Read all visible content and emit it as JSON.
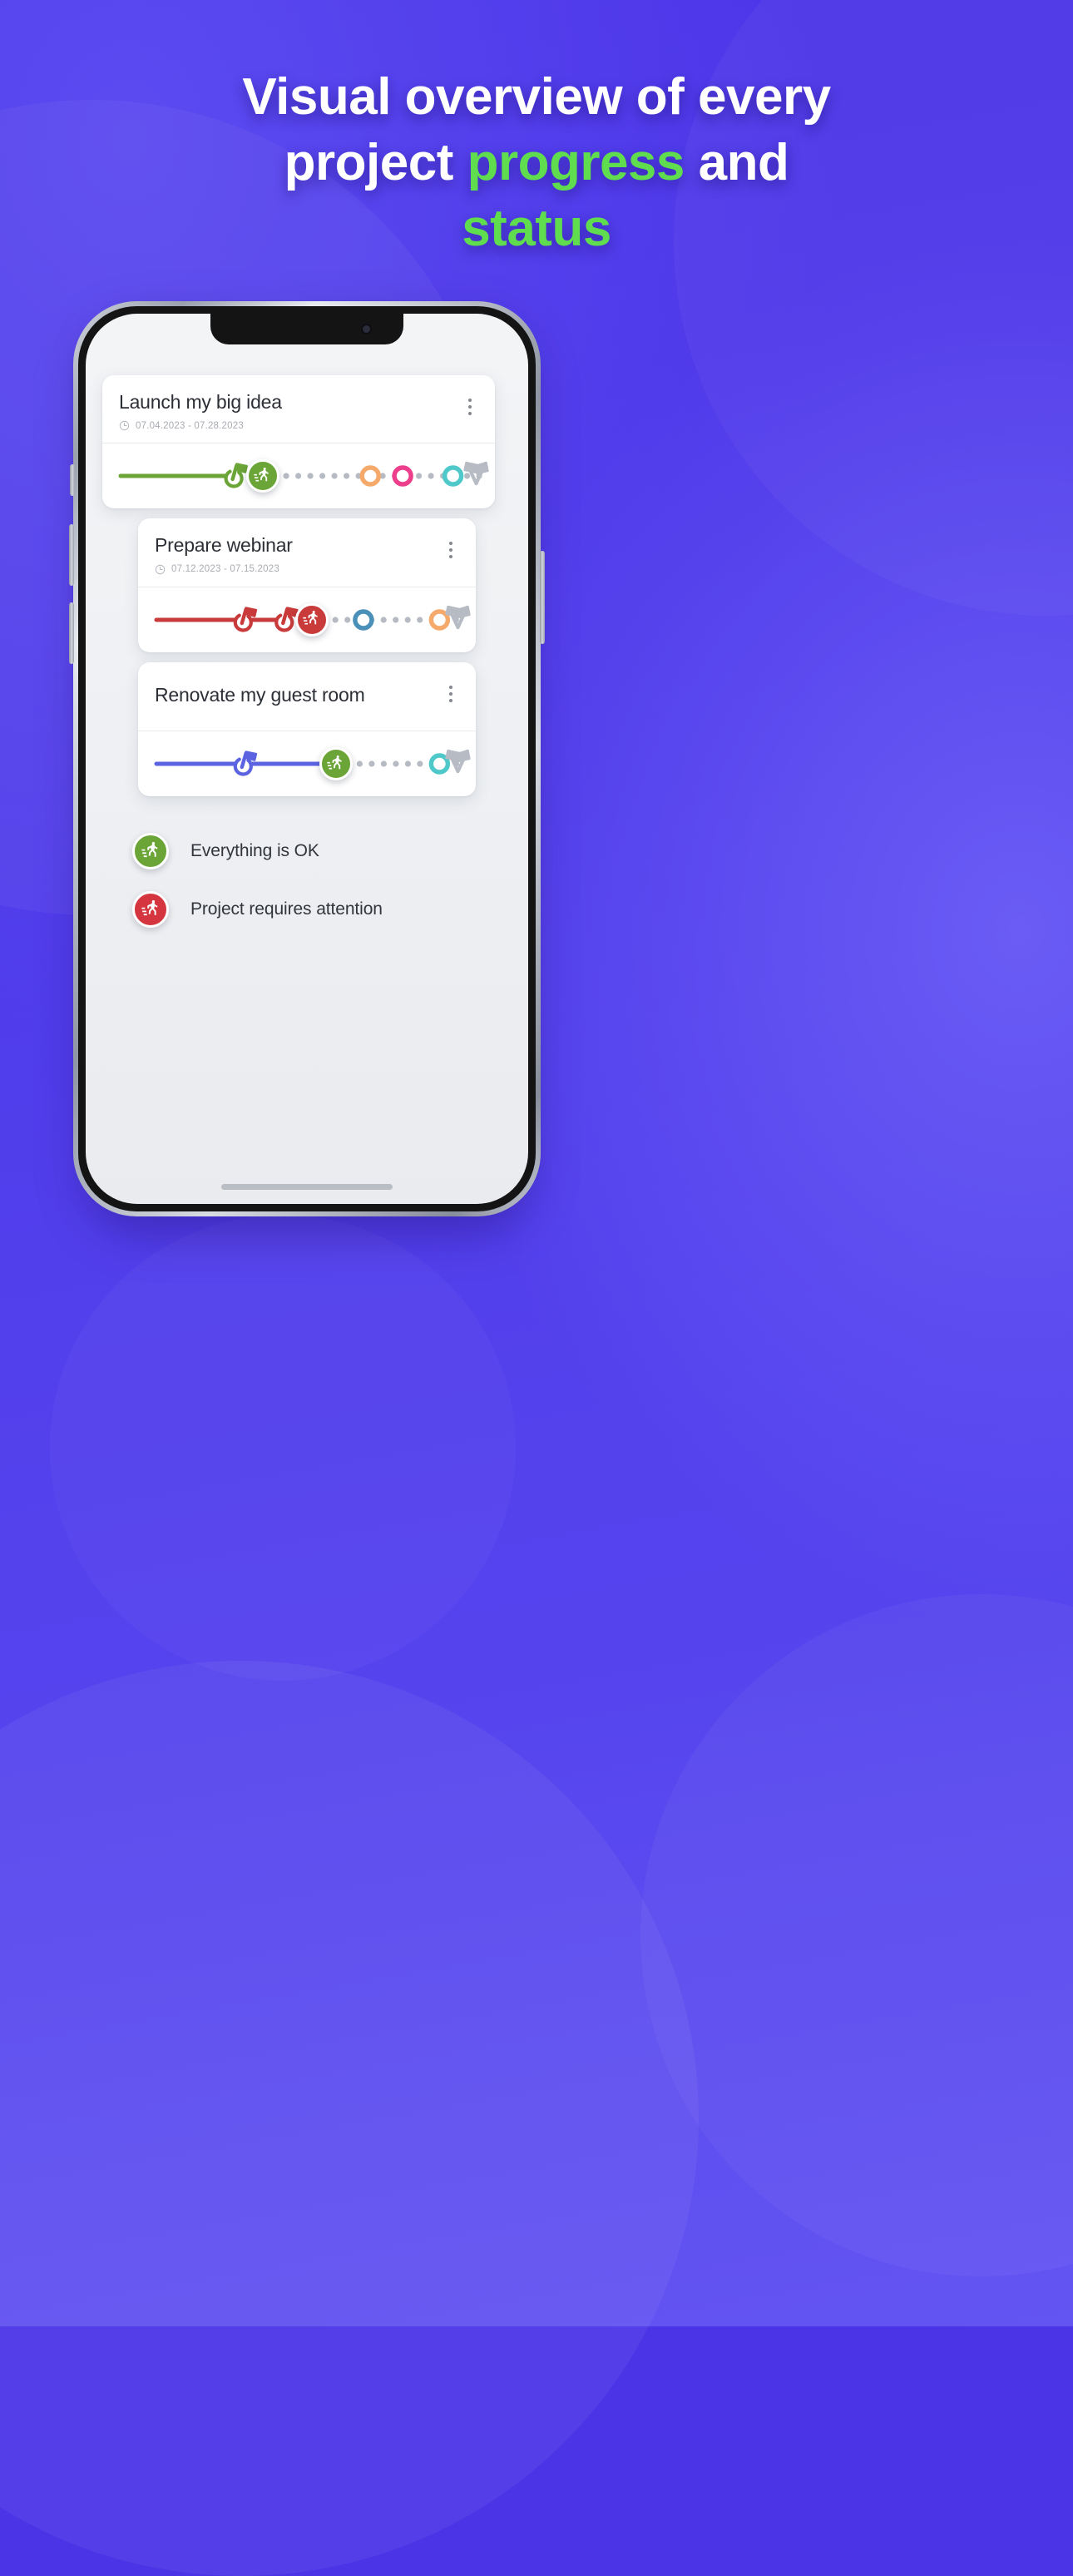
{
  "headline": {
    "line1": "Visual overview of every",
    "line2_a": "project ",
    "line2_accent": "progress",
    "line2_b": " and",
    "line3_accent": "status",
    "accent_color": "#5fdd4e",
    "text_color": "#ffffff"
  },
  "background": {
    "color_start": "#4b33e8",
    "color_end": "#6355f2"
  },
  "app": {
    "cards": [
      {
        "title": "Launch my big idea",
        "date_range": "07.04.2023 - 07.28.2023",
        "clock_icon": "clock-icon",
        "menu_icon": "kebab-menu-icon",
        "has_dates": true,
        "line_color": "#6ba437",
        "status": "ok",
        "status_icon": "runner-icon",
        "milestones": [
          {
            "type": "flag",
            "color": "#6ba437",
            "x": 0.315
          },
          {
            "type": "status-badge",
            "color": "#6ba437",
            "x": 0.395
          },
          {
            "type": "ring",
            "color": "#f5a96b",
            "x": 0.695
          },
          {
            "type": "ring",
            "color": "#ec3e8a",
            "x": 0.785
          },
          {
            "type": "ring",
            "color": "#4ec8c8",
            "x": 0.925
          },
          {
            "type": "finish-flag",
            "color": "#b7bcc4",
            "x": 0.985
          }
        ]
      },
      {
        "title": "Prepare webinar",
        "date_range": "07.12.2023 - 07.15.2023",
        "clock_icon": "clock-icon",
        "menu_icon": "kebab-menu-icon",
        "has_dates": true,
        "line_color": "#c93b3b",
        "status": "attention",
        "status_icon": "runner-icon",
        "milestones": [
          {
            "type": "flag",
            "color": "#c93b3b",
            "x": 0.285
          },
          {
            "type": "flag",
            "color": "#c93b3b",
            "x": 0.42
          },
          {
            "type": "status-badge",
            "color": "#c93b3b",
            "x": 0.51
          },
          {
            "type": "ring",
            "color": "#4a90b8",
            "x": 0.68
          },
          {
            "type": "ring",
            "color": "#f5a96b",
            "x": 0.93
          },
          {
            "type": "finish-flag",
            "color": "#b7bcc4",
            "x": 0.985
          }
        ]
      },
      {
        "title": "Renovate my guest room",
        "date_range": "",
        "clock_icon": "clock-icon",
        "menu_icon": "kebab-menu-icon",
        "has_dates": false,
        "line_color": "#5b63e0",
        "status": "ok",
        "status_icon": "runner-icon",
        "milestones": [
          {
            "type": "flag",
            "color": "#5b63e0",
            "x": 0.285
          },
          {
            "type": "status-badge",
            "color": "#6ba437",
            "x": 0.59
          },
          {
            "type": "ring",
            "color": "#4ec8c8",
            "x": 0.93
          },
          {
            "type": "finish-flag",
            "color": "#b7bcc4",
            "x": 0.985
          }
        ]
      }
    ],
    "legend": [
      {
        "label": "Everything is OK",
        "color": "#6ba437",
        "icon": "runner-icon"
      },
      {
        "label": "Project requires attention",
        "color": "#d4353f",
        "icon": "runner-icon"
      }
    ],
    "dot_color": "#b6bbc3"
  }
}
